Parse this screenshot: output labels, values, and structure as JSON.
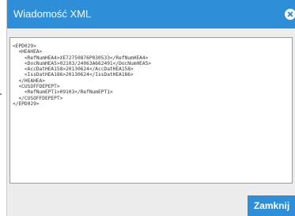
{
  "dialog": {
    "title": "Wiadomość XML",
    "xml_text": "<EPD029>\n  <HEAHEA>\n    <RefNumHEA4>XE72750876P030533</RefNumHEA4>\n    <DocNumHEA5>02103/24063A662491</DocNumHEA5>\n    <AccDatHEA158>20130624</AccDatHEA158>\n    <IssDatHEA186>20130624</IssDatHEA186>\n  </HEAHEA>\n  <CUSOFFDEPEPT>\n    <RefNumEPT1>09103</RefNumEPT1>\n  </CUSOFFDEPEPT>\n</EPD029>",
    "close_button_label": "Zamknij"
  },
  "colors": {
    "accent": "#2e8ed7",
    "dialog_background": "#ececec"
  },
  "icons": {
    "close": "close-icon"
  }
}
